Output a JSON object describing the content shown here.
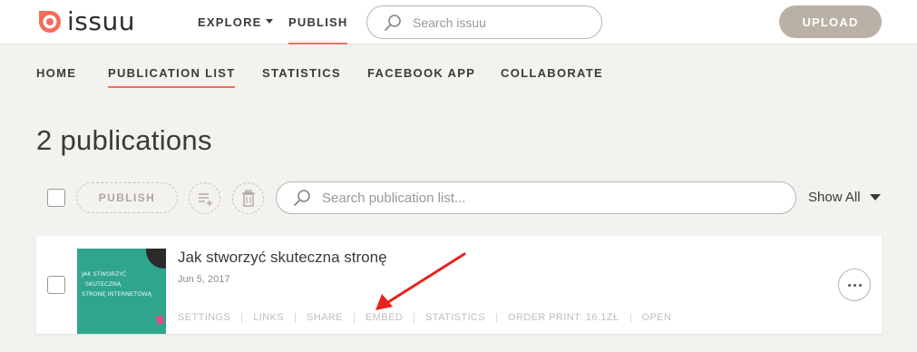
{
  "brand": {
    "logo_text": "issuu",
    "accent": "#f36c5a"
  },
  "topbar": {
    "explore_label": "EXPLORE",
    "publish_label": "PUBLISH",
    "search_placeholder": "Search issuu",
    "upload_label": "UPLOAD"
  },
  "subnav": {
    "items": [
      {
        "label": "HOME"
      },
      {
        "label": "PUBLICATION LIST",
        "active": true
      },
      {
        "label": "STATISTICS"
      },
      {
        "label": "FACEBOOK APP"
      },
      {
        "label": "COLLABORATE"
      }
    ]
  },
  "main": {
    "title": "2 publications",
    "toolbar": {
      "publish_label": "PUBLISH",
      "search_placeholder": "Search publication list...",
      "filter_label": "Show All",
      "icons": [
        "add-to-stack-icon",
        "trash-icon"
      ]
    },
    "publications": [
      {
        "title": "Jak stworzyć skuteczna stronę",
        "date": "Jun 5, 2017",
        "thumbnail": {
          "lines": [
            "JAK STWORZYĆ",
            "SKUTECZNĄ",
            "STRONĘ INTERNETOWĄ"
          ]
        },
        "actions": [
          "SETTINGS",
          "LINKS",
          "SHARE",
          "EMBED",
          "STATISTICS",
          "ORDER PRINT: 16.1ZŁ",
          "OPEN"
        ]
      }
    ]
  },
  "annotation": {
    "color": "#e8221b",
    "points_to": "EMBED"
  }
}
